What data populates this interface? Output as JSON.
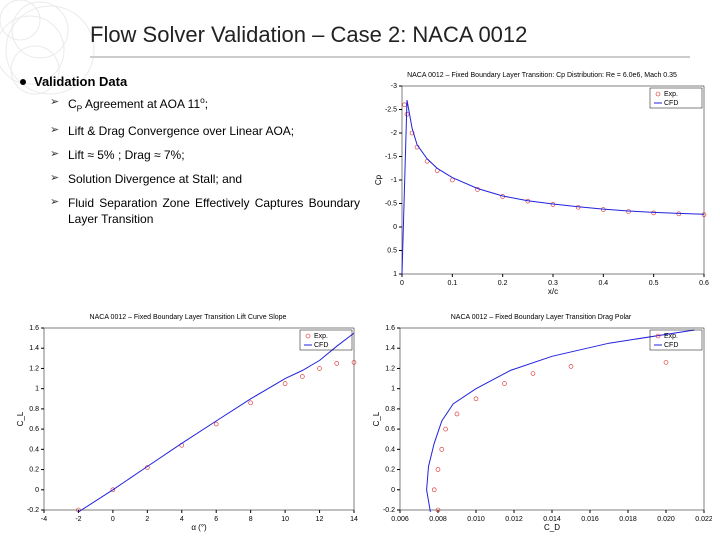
{
  "slide": {
    "title": "Flow Solver Validation – Case 2: NACA 0012",
    "section_heading": "Validation Data",
    "bullets": [
      "C_P Agreement at AOA 11°;",
      "Lift & Drag Convergence over Linear AOA;",
      "Lift ≈ 5% ; Drag ≈ 7%;",
      "Solution Divergence at Stall; and",
      "Fluid Separation Zone Effectively Captures Boundary Layer Transition"
    ]
  },
  "chart_data": [
    {
      "id": "cp",
      "type": "line",
      "title": "NACA 0012 – Fixed Boundary Layer Transition: Cp Distribution: Re = 6.0e6, Mach 0.35",
      "xlabel": "x/c",
      "ylabel": "Cp",
      "xlim": [
        0,
        0.6
      ],
      "ylim": [
        -3,
        1
      ],
      "y_inverted": true,
      "xticks": [
        0,
        0.1,
        0.2,
        0.3,
        0.4,
        0.5,
        0.6
      ],
      "yticks": [
        -3,
        -2.5,
        -2,
        -1.5,
        -1,
        -0.5,
        0,
        0.5,
        1
      ],
      "series": [
        {
          "name": "Exp.",
          "style": "red-marker",
          "x": [
            0.005,
            0.01,
            0.02,
            0.03,
            0.05,
            0.07,
            0.1,
            0.15,
            0.2,
            0.25,
            0.3,
            0.35,
            0.4,
            0.45,
            0.5,
            0.55,
            0.6
          ],
          "y": [
            -2.6,
            -2.4,
            -2.0,
            -1.7,
            -1.4,
            -1.2,
            -1.0,
            -0.8,
            -0.65,
            -0.55,
            -0.48,
            -0.42,
            -0.37,
            -0.33,
            -0.3,
            -0.28,
            -0.26
          ]
        },
        {
          "name": "CFD",
          "style": "blue-line",
          "x": [
            0.0,
            0.01,
            0.02,
            0.03,
            0.05,
            0.07,
            0.1,
            0.15,
            0.2,
            0.25,
            0.3,
            0.35,
            0.4,
            0.45,
            0.5,
            0.55,
            0.6
          ],
          "y": [
            1.0,
            -2.7,
            -2.1,
            -1.75,
            -1.45,
            -1.25,
            -1.05,
            -0.82,
            -0.66,
            -0.56,
            -0.49,
            -0.43,
            -0.38,
            -0.34,
            -0.31,
            -0.29,
            -0.27
          ]
        }
      ]
    },
    {
      "id": "lift",
      "type": "line",
      "title": "NACA 0012 – Fixed Boundary Layer Transition Lift Curve Slope",
      "xlabel": "α (°)",
      "ylabel": "C_L",
      "xlim": [
        -4,
        14
      ],
      "ylim": [
        -0.2,
        1.6
      ],
      "xticks": [
        -4,
        -2,
        0,
        2,
        4,
        6,
        8,
        10,
        12,
        14
      ],
      "yticks": [
        -0.2,
        0,
        0.2,
        0.4,
        0.6,
        0.8,
        1.0,
        1.2,
        1.4,
        1.6
      ],
      "series": [
        {
          "name": "Exp.",
          "style": "red-marker",
          "x": [
            -2,
            0,
            2,
            4,
            6,
            8,
            10,
            11,
            12,
            13,
            14
          ],
          "y": [
            -0.2,
            0.0,
            0.22,
            0.44,
            0.65,
            0.86,
            1.05,
            1.12,
            1.2,
            1.25,
            1.26
          ]
        },
        {
          "name": "CFD",
          "style": "blue-line",
          "x": [
            -2,
            0,
            2,
            4,
            6,
            8,
            10,
            11,
            12,
            13,
            14
          ],
          "y": [
            -0.22,
            0.0,
            0.23,
            0.46,
            0.68,
            0.9,
            1.1,
            1.18,
            1.28,
            1.42,
            1.55
          ]
        }
      ]
    },
    {
      "id": "drag",
      "type": "line",
      "title": "NACA 0012 – Fixed Boundary Layer Transition Drag Polar",
      "xlabel": "C_D",
      "ylabel": "C_L",
      "xlim": [
        0.006,
        0.022
      ],
      "ylim": [
        -0.2,
        1.6
      ],
      "xticks": [
        0.006,
        0.008,
        0.01,
        0.012,
        0.014,
        0.016,
        0.018,
        0.02,
        0.022
      ],
      "yticks": [
        -0.2,
        0,
        0.2,
        0.4,
        0.6,
        0.8,
        1.0,
        1.2,
        1.4,
        1.6
      ],
      "series": [
        {
          "name": "Exp.",
          "style": "red-marker",
          "x": [
            0.008,
            0.0078,
            0.008,
            0.0082,
            0.0084,
            0.009,
            0.01,
            0.0115,
            0.013,
            0.015,
            0.02
          ],
          "y": [
            -0.2,
            0.0,
            0.2,
            0.4,
            0.6,
            0.75,
            0.9,
            1.05,
            1.15,
            1.22,
            1.26
          ]
        },
        {
          "name": "CFD",
          "style": "blue-line",
          "x": [
            0.0076,
            0.0074,
            0.0075,
            0.0078,
            0.0082,
            0.0088,
            0.01,
            0.0118,
            0.014,
            0.017,
            0.0215
          ],
          "y": [
            -0.22,
            0.0,
            0.23,
            0.46,
            0.68,
            0.85,
            1.0,
            1.18,
            1.32,
            1.45,
            1.58
          ]
        }
      ]
    }
  ]
}
